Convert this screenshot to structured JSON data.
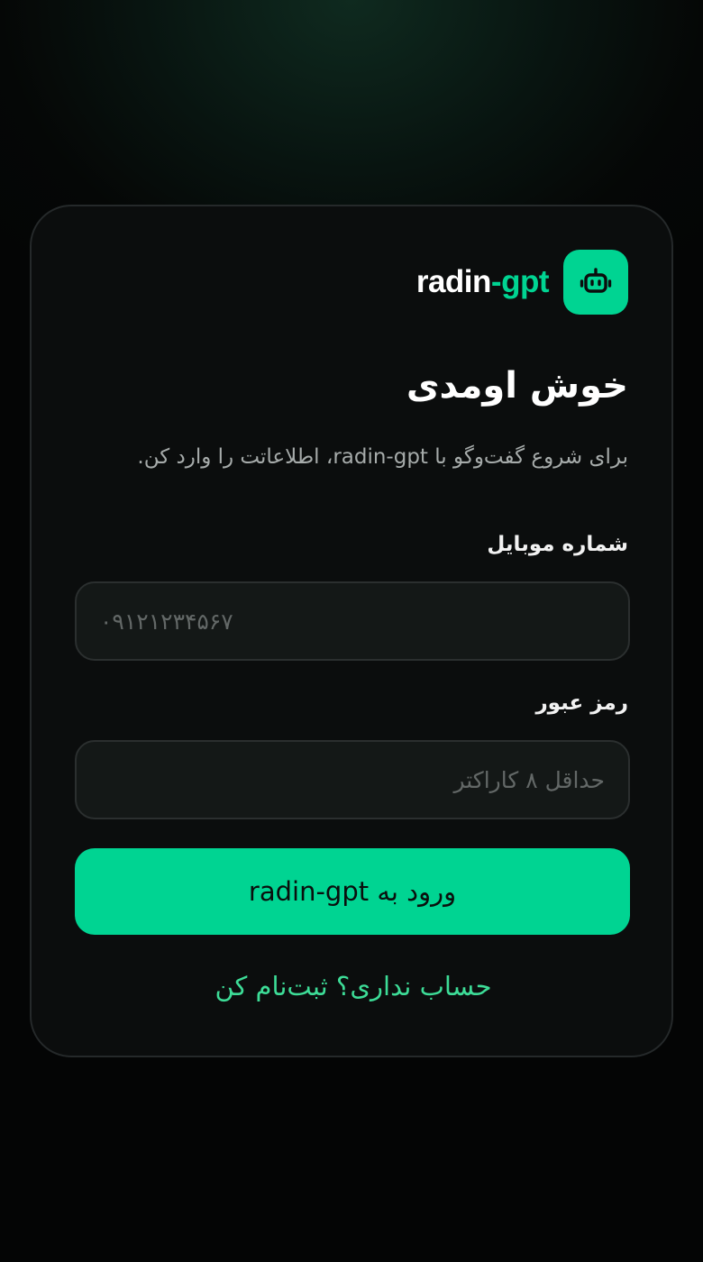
{
  "brand": {
    "name_part1": "radin",
    "name_part2": "-gpt",
    "logo_icon": "bot-icon",
    "accent_color": "#00d492"
  },
  "login": {
    "title": "خوش اومدی",
    "subtitle": "برای شروع گفت‌وگو با radin-gpt، اطلاعاتت را وارد کن.",
    "phone_label": "شماره موبایل",
    "phone_placeholder": "۰۹۱۲۱۲۳۴۵۶۷",
    "phone_value": "",
    "password_label": "رمز عبور",
    "password_placeholder": "حداقل ۸ کاراکتر",
    "password_value": "",
    "submit_label": "ورود به radin-gpt",
    "signup_link": "حساب نداری؟ ثبت‌نام کن"
  }
}
